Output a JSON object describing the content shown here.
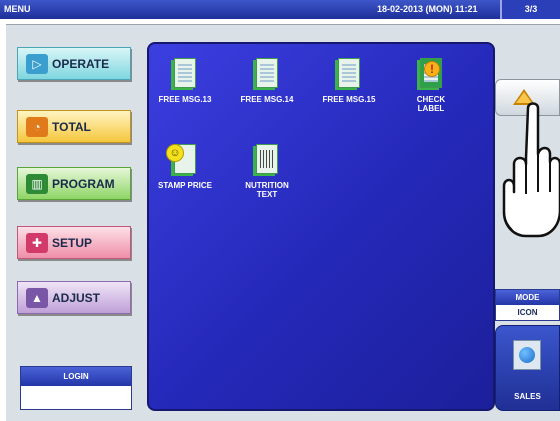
{
  "topbar": {
    "title": "MENU",
    "datetime": "18-02-2013 (MON)  11:21",
    "page": "3/3"
  },
  "menu": {
    "operate": "OPERATE",
    "total": "TOTAL",
    "program": "PROGRAM",
    "setup": "SETUP",
    "adjust": "ADJUST"
  },
  "login": {
    "label": "LOGIN",
    "value": ""
  },
  "items": [
    {
      "line1": "FREE MSG.13",
      "line2": ""
    },
    {
      "line1": "FREE MSG.14",
      "line2": ""
    },
    {
      "line1": "FREE MSG.15",
      "line2": ""
    },
    {
      "line1": "CHECK",
      "line2": "LABEL"
    },
    {
      "line1": "STAMP PRICE",
      "line2": ""
    },
    {
      "line1": "NUTRITION",
      "line2": "TEXT"
    }
  ],
  "mode": {
    "label": "MODE",
    "value": "ICON"
  },
  "sales": {
    "label": "SALES"
  },
  "icons": {
    "operate": "play-icon",
    "total": "clock-icon",
    "program": "book-icon",
    "setup": "wrench-icon",
    "adjust": "adjust-icon",
    "scroll_up": "arrow-up-icon",
    "hand": "pointing-hand-icon"
  }
}
